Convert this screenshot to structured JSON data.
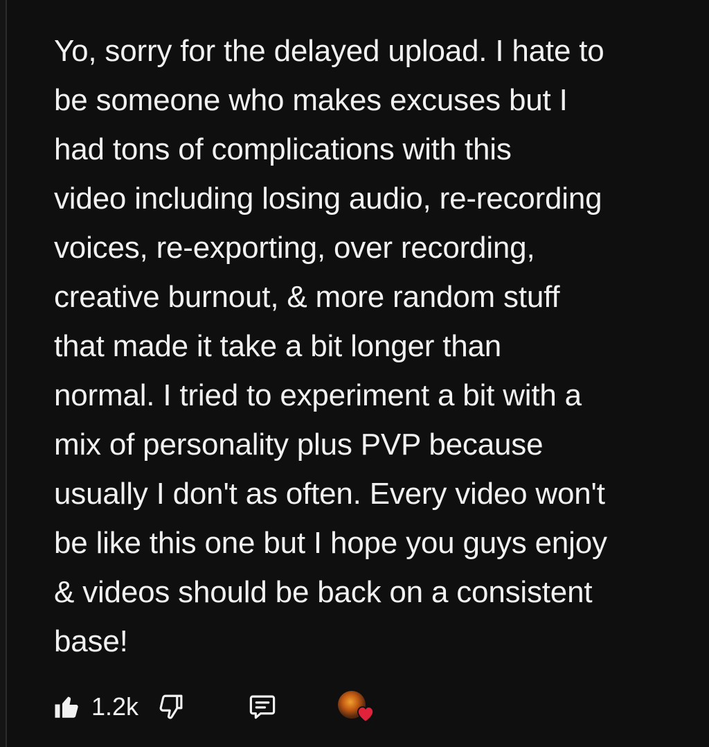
{
  "comment": {
    "lines": [
      "Yo, sorry for the delayed upload. I hate to",
      "be someone who makes excuses but I",
      "had tons of complications with this",
      "video including losing audio, re-recording",
      "voices, re-exporting, over recording,",
      "creative burnout, & more random stuff",
      "that made it take a bit longer than",
      "normal. I tried to experiment a bit with a",
      "mix of personality plus PVP because",
      "usually I don't as often. Every video won't",
      "be like this one but I hope you guys enjoy",
      "& videos should be back on a consistent",
      "base!"
    ]
  },
  "actions": {
    "like_count": "1.2k",
    "like_icon": "thumbs-up-icon",
    "dislike_icon": "thumbs-down-icon",
    "reply_icon": "comment-icon",
    "hearted_icon": "creator-heart-icon"
  },
  "colors": {
    "background": "#0f0f0f",
    "text": "#f1f1f1",
    "heart": "#e0233a"
  }
}
